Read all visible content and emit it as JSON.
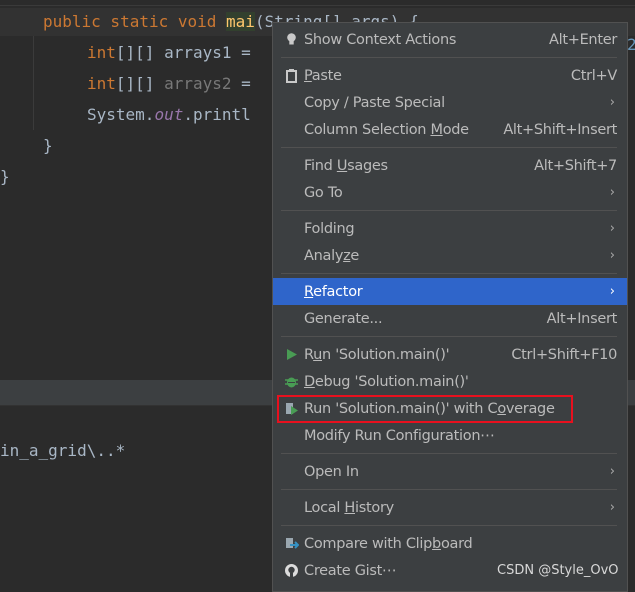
{
  "editor": {
    "line1": {
      "kw": "public static void ",
      "method": "mai",
      "rest": "(String[] args) {"
    },
    "line2": {
      "type": "int",
      "rest": "[][] arrays1 = "
    },
    "line3": {
      "type": "int",
      "rest": "[][] ",
      "var": "arrays2",
      "tail": " ="
    },
    "line4": {
      "pre": "System.",
      "field": "out",
      "post": ".printl"
    },
    "line5": "}",
    "line6": "}",
    "edge_char": "2",
    "output_text": "in_a_grid\\..*"
  },
  "menu": {
    "items": [
      {
        "label": "Show Context Actions",
        "shortcut": "Alt+Enter",
        "icon": "lightbulb-icon"
      },
      {
        "label": "Paste",
        "shortcut": "Ctrl+V",
        "icon": "clipboard-icon"
      },
      {
        "label": "Copy / Paste Special",
        "submenu": true
      },
      {
        "label": "Column Selection Mode",
        "shortcut": "Alt+Shift+Insert"
      },
      {
        "label": "Find Usages",
        "shortcut": "Alt+Shift+7"
      },
      {
        "label": "Go To",
        "submenu": true
      },
      {
        "label": "Folding",
        "submenu": true
      },
      {
        "label": "Analyze",
        "submenu": true
      },
      {
        "label": "Refactor",
        "submenu": true,
        "selected": true
      },
      {
        "label": "Generate...",
        "shortcut": "Alt+Insert"
      },
      {
        "label": "Run 'Solution.main()'",
        "shortcut": "Ctrl+Shift+F10",
        "icon": "run-icon"
      },
      {
        "label": "Debug 'Solution.main()'",
        "icon": "debug-bug-icon"
      },
      {
        "label": "Run 'Solution.main()' with Coverage",
        "icon": "coverage-icon",
        "highlighted": true
      },
      {
        "label": "Modify Run Configuration⋯"
      },
      {
        "label": "Open In",
        "submenu": true
      },
      {
        "label": "Local History",
        "submenu": true
      },
      {
        "label": "Compare with Clipboard",
        "icon": "compare-icon"
      },
      {
        "label": "Create Gist⋯",
        "icon": "github-icon"
      }
    ],
    "chevron": "›"
  },
  "watermark": "CSDN @Style_OvO",
  "colors": {
    "selection": "#2f65ca",
    "highlight_box": "#e8101e",
    "menu_bg": "#3c3f41",
    "editor_bg": "#2b2b2b"
  }
}
